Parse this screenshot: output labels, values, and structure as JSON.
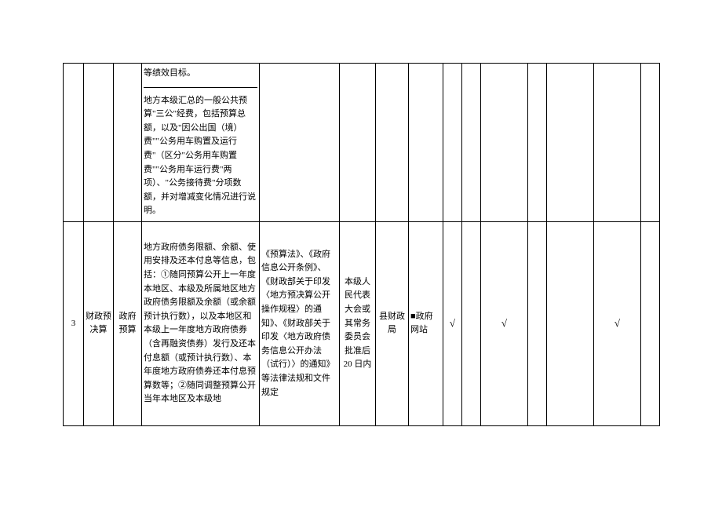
{
  "row1": {
    "cell_a": "等绩效目标。",
    "cell_b": "地方本级汇总的一般公共预算\"三公\"经费，包括预算总额，以及\"因公出国（境）费\"\"公务用车购置及运行费\"（区分\"公务用车购置费\"\"公务用车运行费\"两项）、\"公务接待费\"分项数额，并对增减变化情况进行说明。"
  },
  "row2": {
    "num": "3",
    "category": "财政预决算",
    "subcat": "政府预算",
    "content": "地方政府债务限额、余额、使用安排及还本付息等信息，包括：①随同预算公开上一年度本地区、本级及所属地区地方政府债务限额及余额（或余额预计执行数），以及本地区和本级上一年度地方政府债券（含再融资债券）发行及还本付息额（或预计执行数）、本年度地方政府债券还本付息预算数等；②随同调整预算公开当年本地区及本级地",
    "basis": "《预算法》、《政府信息公开条例》、《财政部关于印发〈地方预决算公开操作规程〉的通知》、《财政部关于印发〈地方政府债务信息公开办法（试行）〉的通知》等法律法规和文件规定",
    "timing": "本级人民代表大会或其常务委员会批准后20 日内",
    "dept": "县财政局",
    "channel": "■政府网站",
    "check1": "√",
    "check2": "",
    "check3": "√",
    "check4": "",
    "check5": "",
    "check6": "√",
    "check7": ""
  }
}
